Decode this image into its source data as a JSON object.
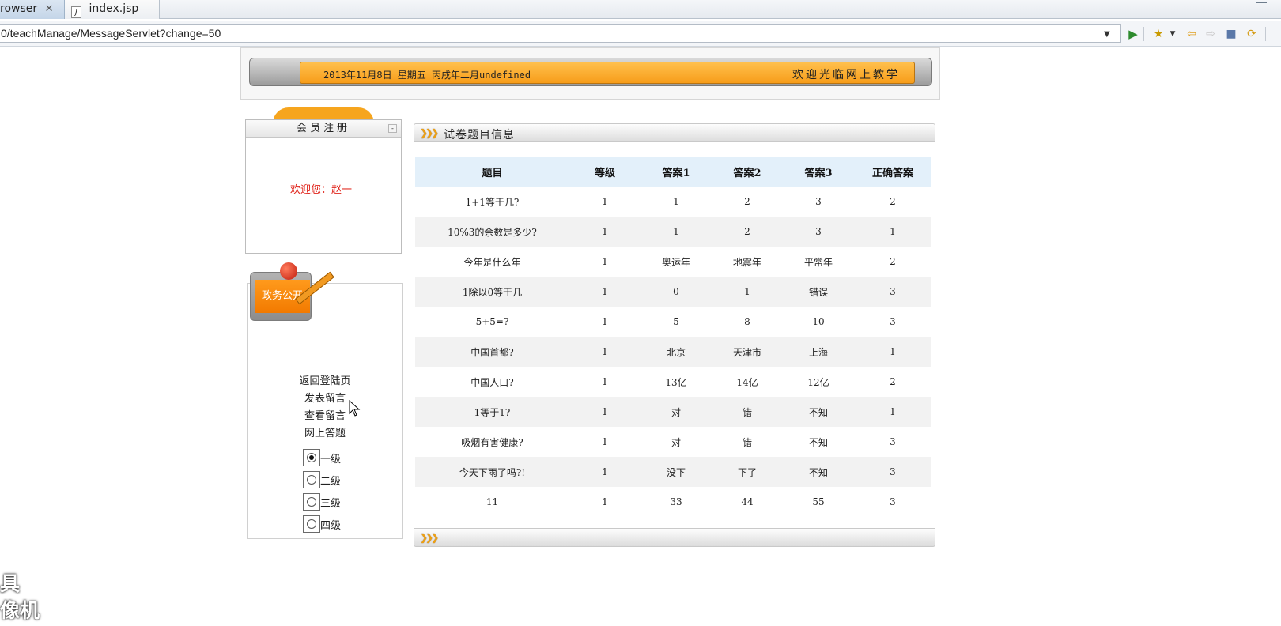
{
  "tabs": {
    "browser_label": "rowser",
    "close_glyph": "✕",
    "file_label": "index.jsp",
    "file_icon": "J"
  },
  "urlbar": {
    "value": "0/teachManage/MessageServlet?change=50",
    "icons": [
      "dropdown-icon",
      "go-icon",
      "favorites-icon",
      "back-icon",
      "forward-icon",
      "stop-icon",
      "refresh-icon"
    ]
  },
  "banner": {
    "date_text": "2013年11月8日 星期五 丙戌年二月undefined",
    "welcome_text": "欢迎光临网上教学"
  },
  "member": {
    "title": "会员注册",
    "welcome": "欢迎您：赵一"
  },
  "affairs": {
    "label": "政务公开"
  },
  "nav": {
    "items": [
      "返回登陆页",
      "发表留言",
      "查看留言",
      "网上答题"
    ]
  },
  "levels": {
    "options": [
      "一级",
      "二级",
      "三级",
      "四级"
    ],
    "selected_index": 0
  },
  "panel": {
    "title": "试卷题目信息",
    "chevrons": "❯❯❯"
  },
  "table": {
    "headers": [
      "题目",
      "等级",
      "答案1",
      "答案2",
      "答案3",
      "正确答案"
    ],
    "rows": [
      [
        "1+1等于几?",
        "1",
        "1",
        "2",
        "3",
        "2"
      ],
      [
        "10%3的余数是多少?",
        "1",
        "1",
        "2",
        "3",
        "1"
      ],
      [
        "今年是什么年",
        "1",
        "奥运年",
        "地震年",
        "平常年",
        "2"
      ],
      [
        "1除以0等于几",
        "1",
        "0",
        "1",
        "错误",
        "3"
      ],
      [
        "5+5=?",
        "1",
        "5",
        "8",
        "10",
        "3"
      ],
      [
        "中国首都?",
        "1",
        "北京",
        "天津市",
        "上海",
        "1"
      ],
      [
        "中国人口?",
        "1",
        "13亿",
        "14亿",
        "12亿",
        "2"
      ],
      [
        "1等于1?",
        "1",
        "对",
        "错",
        "不知",
        "1"
      ],
      [
        "吸烟有害健康?",
        "1",
        "对",
        "错",
        "不知",
        "3"
      ],
      [
        "今天下雨了吗?!",
        "1",
        "没下",
        "下了",
        "不知",
        "3"
      ],
      [
        "11",
        "1",
        "33",
        "44",
        "55",
        "3"
      ]
    ]
  },
  "watermark": {
    "line1": "具",
    "line2": "像机"
  },
  "colors": {
    "accent_orange": "#f79d1a",
    "welcome_red": "#e0241b",
    "header_blue": "#e3f0fa"
  }
}
